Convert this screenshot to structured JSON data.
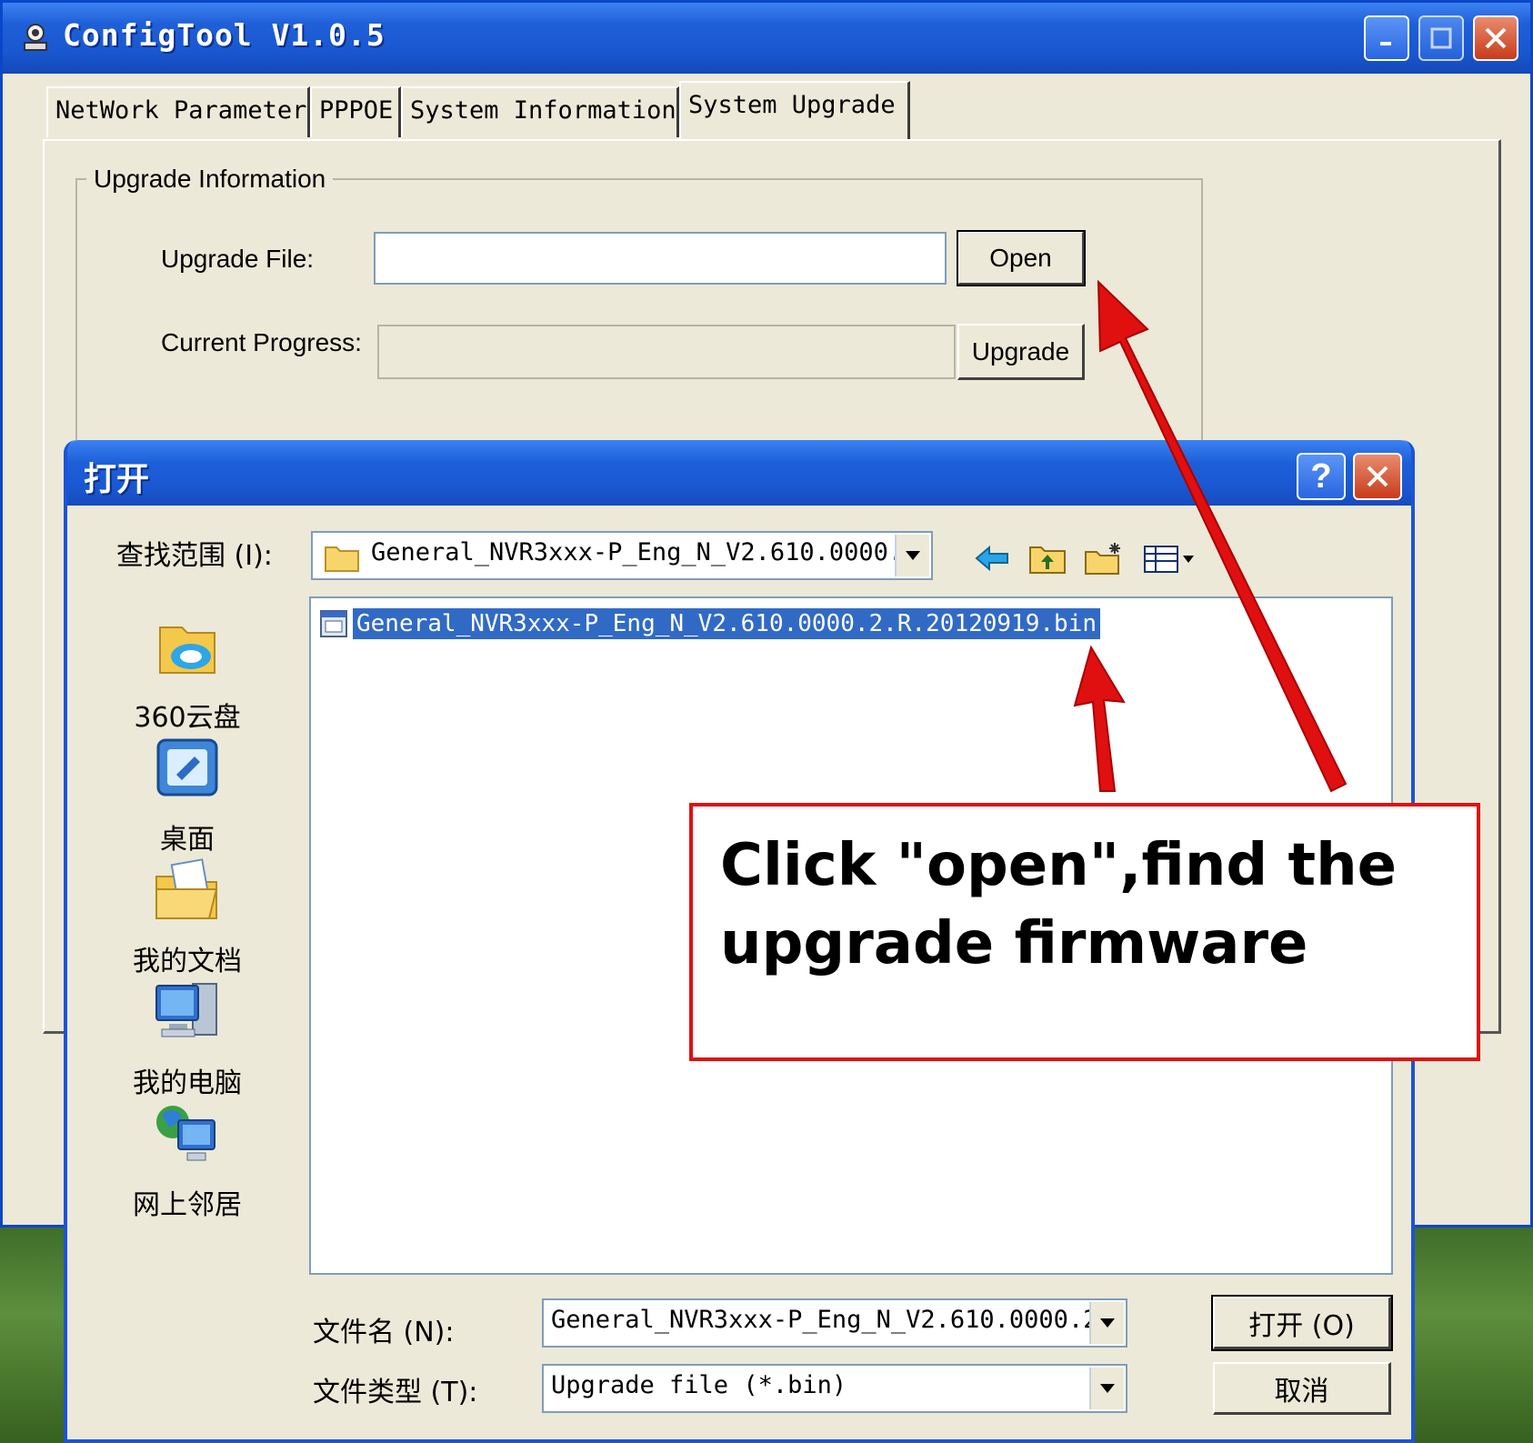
{
  "app": {
    "title": "ConfigTool V1.0.5",
    "tabs": [
      {
        "label": "NetWork Parameter"
      },
      {
        "label": "PPPOE"
      },
      {
        "label": "System Information"
      },
      {
        "label": "System Upgrade"
      }
    ],
    "group_title": "Upgrade Information",
    "upgrade_file_label": "Upgrade File:",
    "upgrade_file_value": "",
    "open_button": "Open",
    "progress_label": "Current Progress:",
    "progress_value": 0,
    "upgrade_button": "Upgrade"
  },
  "dialog": {
    "title": "打开",
    "help_label": "?",
    "look_in_label": "查找范围 (I):",
    "look_in_value": "General_NVR3xxx-P_Eng_N_V2.610.0000.",
    "places": [
      {
        "label": "360云盘",
        "icon": "cloud-folder-icon"
      },
      {
        "label": "桌面",
        "icon": "desktop-icon"
      },
      {
        "label": "我的文档",
        "icon": "my-documents-icon"
      },
      {
        "label": "我的电脑",
        "icon": "my-computer-icon"
      },
      {
        "label": "网上邻居",
        "icon": "network-places-icon"
      }
    ],
    "files": [
      {
        "name": "General_NVR3xxx-P_Eng_N_V2.610.0000.2.R.20120919.bin",
        "selected": true
      }
    ],
    "filename_label": "文件名 (N):",
    "filename_value": "General_NVR3xxx-P_Eng_N_V2.610.0000.2.",
    "filetype_label": "文件类型 (T):",
    "filetype_value": "Upgrade file (*.bin)",
    "open_button": "打开 (O)",
    "cancel_button": "取消"
  },
  "annotation": {
    "text": "Click \"open\",find the upgrade firmware",
    "border_color": "#e01010",
    "arrow_color": "#e01010"
  },
  "colors": {
    "titlebar": "#1f5fd8",
    "window_bg": "#ece9d8",
    "selection": "#316ac5"
  }
}
